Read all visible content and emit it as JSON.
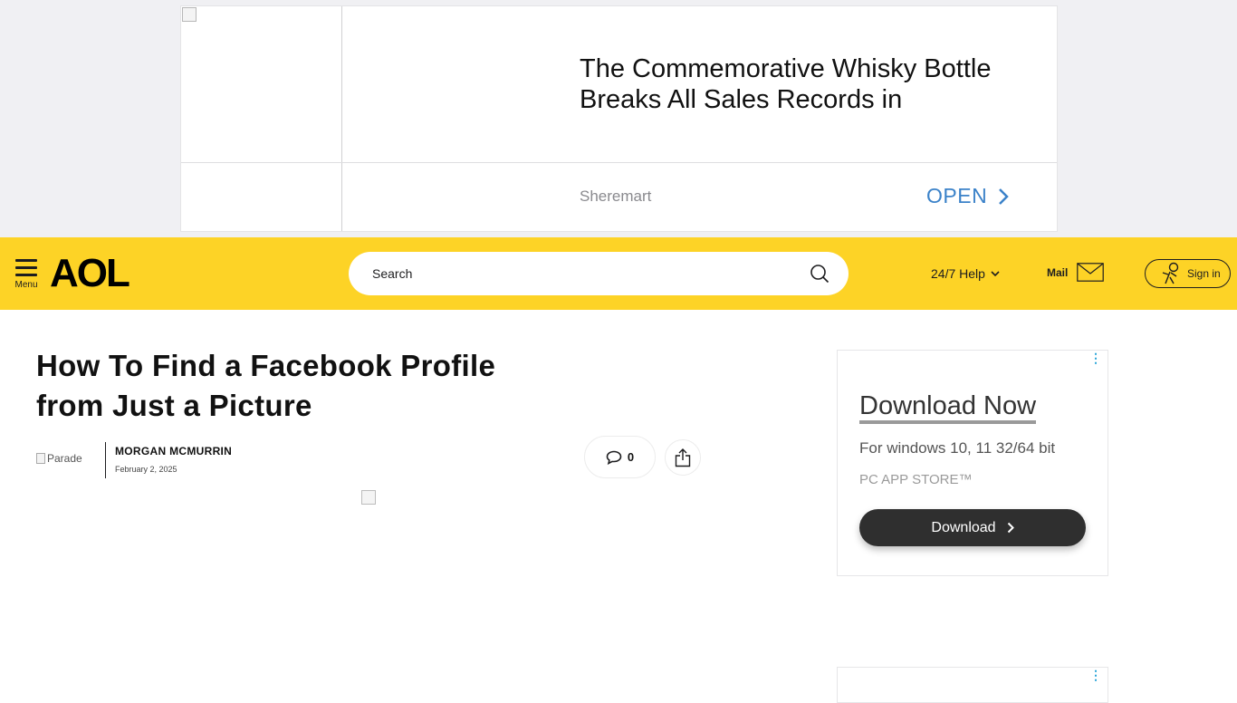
{
  "top_ad": {
    "headline": "The Commemorative Whisky Bottle Breaks All Sales Records in",
    "advertiser": "Sheremart",
    "cta": "OPEN"
  },
  "header": {
    "menu_label": "Menu",
    "logo": "AOL",
    "search_placeholder": "Search",
    "help_label": "24/7 Help",
    "mail_label": "Mail",
    "signin_label": "Sign in",
    "brand_color": "#fdd326"
  },
  "article": {
    "title": "How To Find a Facebook Profile from Just a Picture",
    "publisher_alt": "Parade",
    "author": "MORGAN MCMURRIN",
    "date": "February 2, 2025",
    "comment_count": "0"
  },
  "side_ad": {
    "headline": "Download Now",
    "subtitle": "For windows 10, 11 32/64 bit",
    "store": "PC APP STORE™",
    "button_label": "Download"
  },
  "icons": [
    "menu-icon",
    "search-icon",
    "chevron-down-icon",
    "mail-icon",
    "user-icon",
    "comment-icon",
    "share-icon",
    "chevron-right-icon",
    "adchoices-icon"
  ]
}
